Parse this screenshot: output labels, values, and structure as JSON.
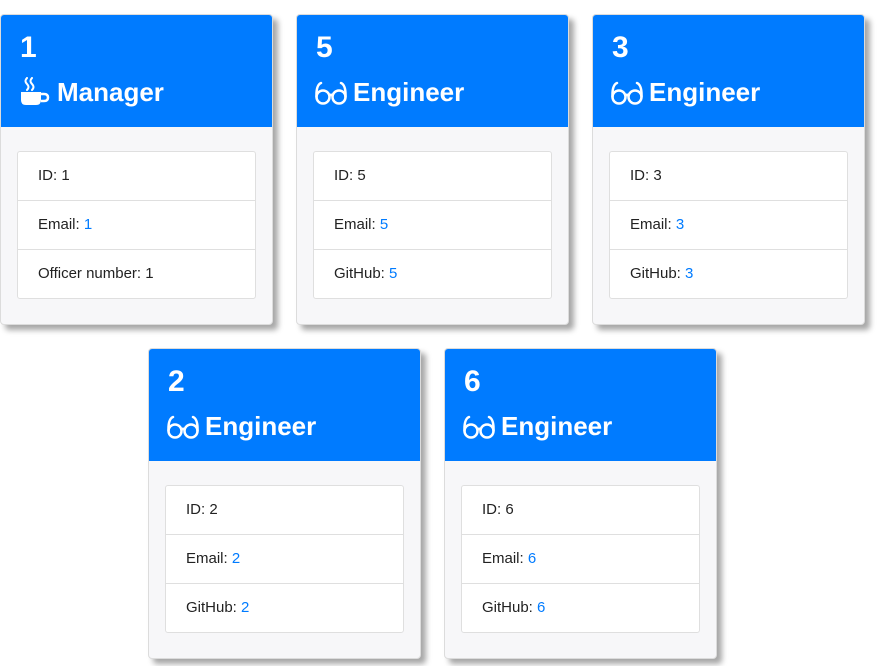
{
  "colors": {
    "header": "#007bff",
    "link": "#007bff",
    "card_body": "#f7f7f9"
  },
  "cards": [
    {
      "name": "1",
      "role": "Manager",
      "role_icon": "coffee-mug-icon",
      "id_label": "ID:",
      "id": "1",
      "email_label": "Email:",
      "email": "1",
      "extra_label": "Officer number:",
      "extra": "1"
    },
    {
      "name": "5",
      "role": "Engineer",
      "role_icon": "glasses-icon",
      "id_label": "ID:",
      "id": "5",
      "email_label": "Email:",
      "email": "5",
      "extra_label": "GitHub:",
      "extra": "5"
    },
    {
      "name": "3",
      "role": "Engineer",
      "role_icon": "glasses-icon",
      "id_label": "ID:",
      "id": "3",
      "email_label": "Email:",
      "email": "3",
      "extra_label": "GitHub:",
      "extra": "3"
    },
    {
      "name": "2",
      "role": "Engineer",
      "role_icon": "glasses-icon",
      "id_label": "ID:",
      "id": "2",
      "email_label": "Email:",
      "email": "2",
      "extra_label": "GitHub:",
      "extra": "2"
    },
    {
      "name": "6",
      "role": "Engineer",
      "role_icon": "glasses-icon",
      "id_label": "ID:",
      "id": "6",
      "email_label": "Email:",
      "email": "6",
      "extra_label": "GitHub:",
      "extra": "6"
    }
  ]
}
